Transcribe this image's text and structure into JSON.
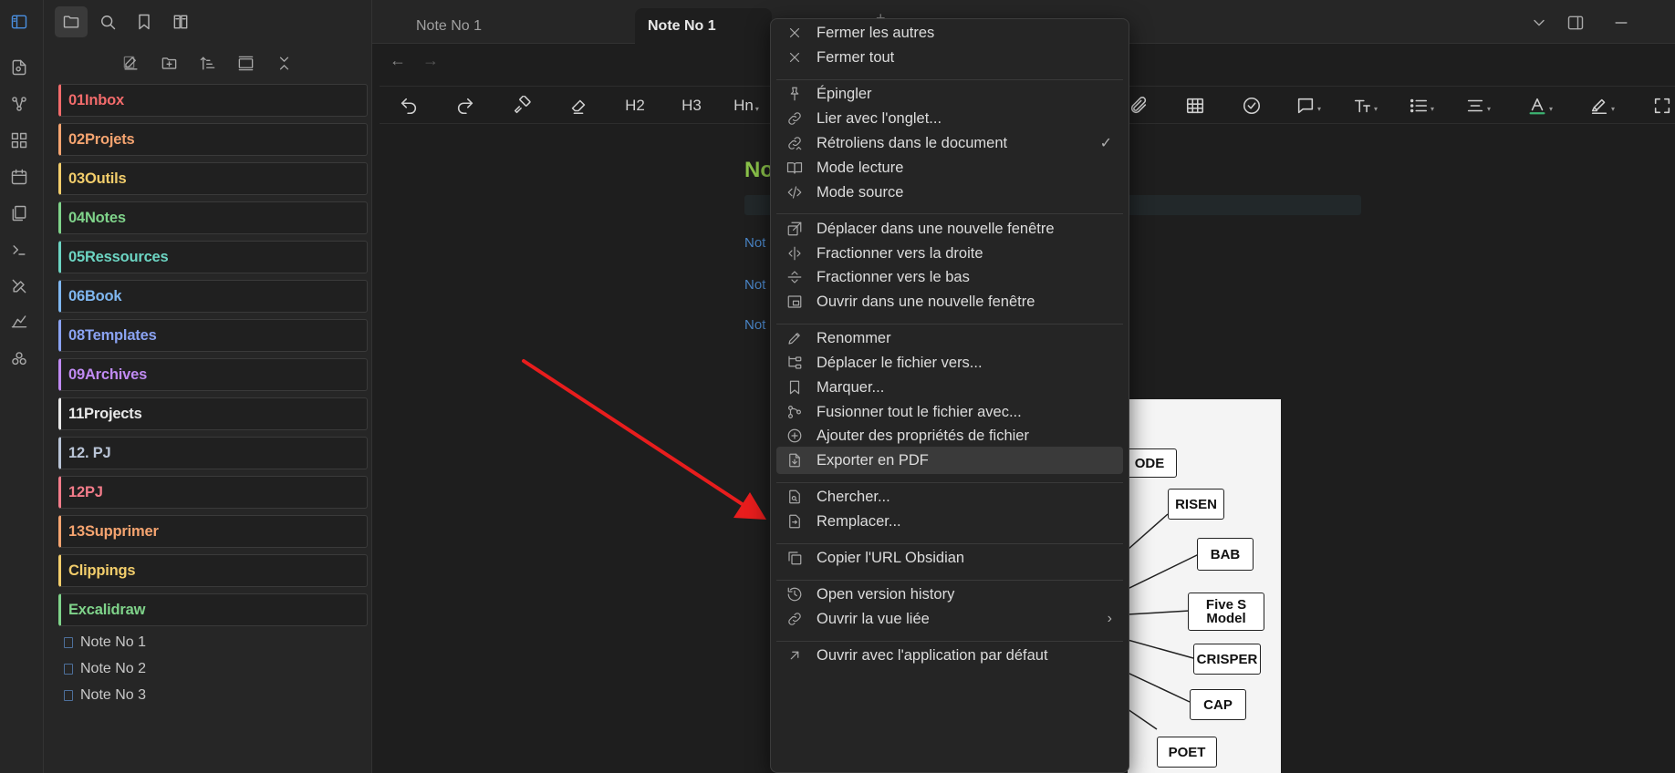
{
  "colors": {
    "accent_title": "#8bc34a",
    "link": "#4a86c8",
    "arrow": "#e81d1d"
  },
  "tabs": [
    {
      "label": "Note No 1"
    },
    {
      "label": "Note No 1"
    }
  ],
  "toolbar": {
    "h2": "H2",
    "h3": "H3",
    "hn": "Hn"
  },
  "sidebar": {
    "folders": [
      {
        "label": "01Inbox",
        "color": "#f26b6b"
      },
      {
        "label": "02Projets",
        "color": "#f5a470"
      },
      {
        "label": "03Outils",
        "color": "#f2cd6b"
      },
      {
        "label": "04Notes",
        "color": "#7fd38a"
      },
      {
        "label": "05Ressources",
        "color": "#6cd4c2"
      },
      {
        "label": "06Book",
        "color": "#7fb7f0"
      },
      {
        "label": "08Templates",
        "color": "#8aa2f2"
      },
      {
        "label": "09Archives",
        "color": "#c08af2"
      },
      {
        "label": "11Projects",
        "color": "#e8e8e8"
      },
      {
        "label": "12. PJ",
        "color": "#b9c4d6"
      },
      {
        "label": "12PJ",
        "color": "#f27c8a"
      },
      {
        "label": "13Supprimer",
        "color": "#f5a470"
      },
      {
        "label": "Clippings",
        "color": "#f2cd6b"
      },
      {
        "label": "Excalidraw",
        "color": "#7fd38a"
      }
    ],
    "files": [
      {
        "label": "Note No 1"
      },
      {
        "label": "Note No 2"
      },
      {
        "label": "Note No 3"
      }
    ]
  },
  "editor": {
    "title_partial": "No",
    "links": [
      "Not",
      "Not",
      "Not"
    ]
  },
  "diagram": {
    "nodes": [
      "ODE",
      "RISEN",
      "BAB",
      "Five S Model",
      "CRISPER",
      "CAP",
      "POET"
    ]
  },
  "menu": {
    "items": [
      {
        "label": "Fermer les autres",
        "icon": "close-icon"
      },
      {
        "label": "Fermer tout",
        "icon": "close-icon"
      },
      {
        "label": "Épingler",
        "icon": "pin-icon"
      },
      {
        "label": "Lier avec l'onglet...",
        "icon": "link-icon"
      },
      {
        "label": "Rétroliens dans le document",
        "icon": "backlink-icon",
        "right": "✓"
      },
      {
        "label": "Mode lecture",
        "icon": "book-open-icon"
      },
      {
        "label": "Mode source",
        "icon": "code-icon"
      },
      {
        "label": "Déplacer dans une nouvelle fenêtre",
        "icon": "move-window-icon"
      },
      {
        "label": "Fractionner vers la droite",
        "icon": "split-right-icon"
      },
      {
        "label": "Fractionner vers le bas",
        "icon": "split-down-icon"
      },
      {
        "label": "Ouvrir dans une nouvelle fenêtre",
        "icon": "new-window-icon"
      },
      {
        "label": "Renommer",
        "icon": "pencil-icon"
      },
      {
        "label": "Déplacer le fichier vers...",
        "icon": "folder-tree-icon"
      },
      {
        "label": "Marquer...",
        "icon": "bookmark-icon"
      },
      {
        "label": "Fusionner tout le fichier avec...",
        "icon": "merge-icon"
      },
      {
        "label": "Ajouter des propriétés de fichier",
        "icon": "plus-circle-icon"
      },
      {
        "label": "Exporter en PDF",
        "icon": "file-download-icon"
      },
      {
        "label": "Chercher...",
        "icon": "file-search-icon"
      },
      {
        "label": "Remplacer...",
        "icon": "file-replace-icon"
      },
      {
        "label": "Copier l'URL Obsidian",
        "icon": "copy-icon"
      },
      {
        "label": "Open version history",
        "icon": "history-icon"
      },
      {
        "label": "Ouvrir la vue liée",
        "icon": "link-icon",
        "right": "›"
      },
      {
        "label": "Ouvrir avec l'application par défaut",
        "icon": "external-icon"
      }
    ]
  }
}
